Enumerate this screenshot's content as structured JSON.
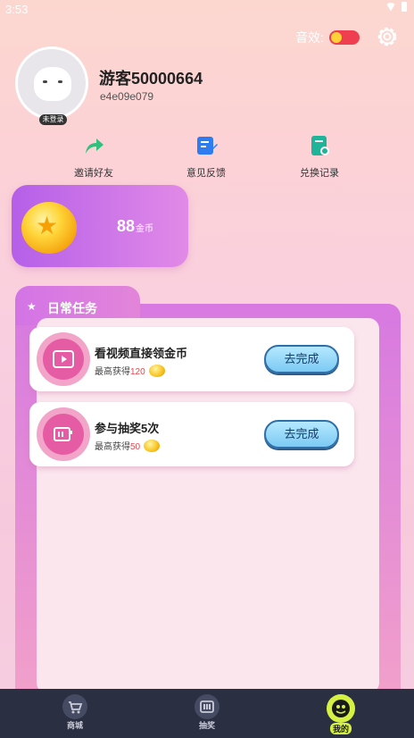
{
  "status": {
    "time": "3:53"
  },
  "settings": {
    "sound_label": "音效:",
    "sound_on": true
  },
  "profile": {
    "username": "游客50000664",
    "user_id": "e4e09e079",
    "login_badge": "未登录"
  },
  "quick_actions": [
    {
      "label": "邀请好友",
      "icon": "share-arrow-icon",
      "color": "#2ec27e"
    },
    {
      "label": "意见反馈",
      "icon": "feedback-note-icon",
      "color": "#2f7bf0"
    },
    {
      "label": "兑换记录",
      "icon": "record-doc-icon",
      "color": "#1fb39a"
    }
  ],
  "coins": {
    "amount": "88",
    "unit": "金币"
  },
  "tasks": {
    "header": "日常任务",
    "items": [
      {
        "title": "看视频直接领金币",
        "reward_prefix": "最高获得",
        "reward": "120",
        "button": "去完成",
        "icon": "video-icon"
      },
      {
        "title": "参与抽奖5次",
        "reward_prefix": "最高获得",
        "reward": "50",
        "button": "去完成",
        "icon": "lottery-icon"
      }
    ]
  },
  "nav": {
    "items": [
      {
        "label": "商城",
        "icon": "cart-icon",
        "active": false
      },
      {
        "label": "抽奖",
        "icon": "lottery-machine-icon",
        "active": false
      },
      {
        "label": "我的",
        "icon": "smiley-icon",
        "active": true
      }
    ]
  },
  "colors": {
    "accent_pink": "#e65ca4",
    "button_blue": "#7ccaf3",
    "nav_active": "#d5f243",
    "nav_bg": "#2a2f42"
  }
}
